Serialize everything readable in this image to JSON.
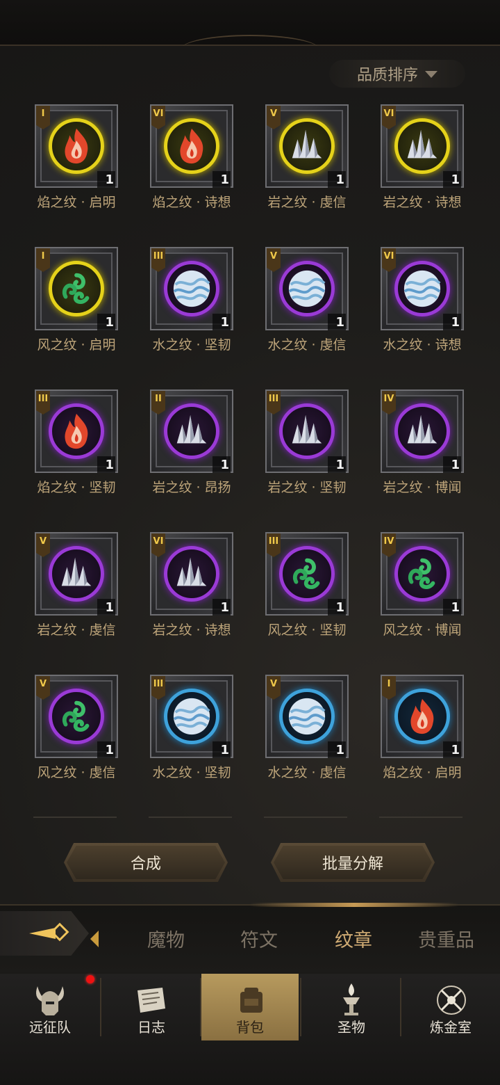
{
  "sort": {
    "label": "品质排序"
  },
  "items": [
    {
      "tier": "I",
      "name": "焰之纹 · 启明",
      "count": "1",
      "element": "fire",
      "rarity": "yellow"
    },
    {
      "tier": "VI",
      "name": "焰之纹 · 诗想",
      "count": "1",
      "element": "fire",
      "rarity": "yellow"
    },
    {
      "tier": "V",
      "name": "岩之纹 · 虔信",
      "count": "1",
      "element": "rock",
      "rarity": "yellow"
    },
    {
      "tier": "VI",
      "name": "岩之纹 · 诗想",
      "count": "1",
      "element": "rock",
      "rarity": "yellow"
    },
    {
      "tier": "I",
      "name": "风之纹 · 启明",
      "count": "1",
      "element": "wind",
      "rarity": "yellow"
    },
    {
      "tier": "III",
      "name": "水之纹 · 坚韧",
      "count": "1",
      "element": "water",
      "rarity": "purple"
    },
    {
      "tier": "V",
      "name": "水之纹 · 虔信",
      "count": "1",
      "element": "water",
      "rarity": "purple"
    },
    {
      "tier": "VI",
      "name": "水之纹 · 诗想",
      "count": "1",
      "element": "water",
      "rarity": "purple"
    },
    {
      "tier": "III",
      "name": "焰之纹 · 坚韧",
      "count": "1",
      "element": "fire",
      "rarity": "purple"
    },
    {
      "tier": "II",
      "name": "岩之纹 · 昂扬",
      "count": "1",
      "element": "rock",
      "rarity": "purple"
    },
    {
      "tier": "III",
      "name": "岩之纹 · 坚韧",
      "count": "1",
      "element": "rock",
      "rarity": "purple"
    },
    {
      "tier": "IV",
      "name": "岩之纹 · 博闻",
      "count": "1",
      "element": "rock",
      "rarity": "purple"
    },
    {
      "tier": "V",
      "name": "岩之纹 · 虔信",
      "count": "1",
      "element": "rock",
      "rarity": "purple"
    },
    {
      "tier": "VI",
      "name": "岩之纹 · 诗想",
      "count": "1",
      "element": "rock",
      "rarity": "purple"
    },
    {
      "tier": "III",
      "name": "风之纹 · 坚韧",
      "count": "1",
      "element": "wind",
      "rarity": "purple"
    },
    {
      "tier": "IV",
      "name": "风之纹 · 博闻",
      "count": "1",
      "element": "wind",
      "rarity": "purple"
    },
    {
      "tier": "V",
      "name": "风之纹 · 虔信",
      "count": "1",
      "element": "wind",
      "rarity": "purple"
    },
    {
      "tier": "III",
      "name": "水之纹 · 坚韧",
      "count": "1",
      "element": "water",
      "rarity": "blue"
    },
    {
      "tier": "V",
      "name": "水之纹 · 虔信",
      "count": "1",
      "element": "water",
      "rarity": "blue"
    },
    {
      "tier": "I",
      "name": "焰之纹 · 启明",
      "count": "1",
      "element": "fire",
      "rarity": "blue"
    }
  ],
  "actions": {
    "synthesize": "合成",
    "batch_decompose": "批量分解"
  },
  "tabs": [
    {
      "label": "魔物",
      "active": false
    },
    {
      "label": "符文",
      "active": false
    },
    {
      "label": "纹章",
      "active": true
    },
    {
      "label": "贵重品",
      "active": false
    }
  ],
  "nav": [
    {
      "label": "远征队",
      "icon": "helmet-icon",
      "badge": true
    },
    {
      "label": "日志",
      "icon": "scroll-icon",
      "badge": false
    },
    {
      "label": "背包",
      "icon": "backpack-icon",
      "badge": false,
      "active": true
    },
    {
      "label": "圣物",
      "icon": "brazier-icon",
      "badge": false
    },
    {
      "label": "炼金室",
      "icon": "alchemy-icon",
      "badge": false
    }
  ],
  "colors": {
    "yellow": "#e5d21a",
    "purple": "#9a3ad6",
    "blue": "#3ea2db",
    "gold_text": "#bea57a",
    "active_tab": "#d1ac74"
  }
}
